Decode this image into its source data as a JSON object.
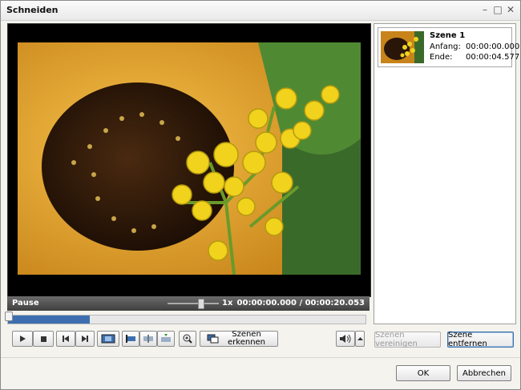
{
  "window": {
    "title": "Schneiden"
  },
  "player": {
    "status": "Pause",
    "speed": "1x",
    "timecode": "00:00:00.000 / 00:00:20.053",
    "position_fraction": 0.0
  },
  "controls": {
    "icons": [
      "play-icon",
      "stop-icon",
      "prev-frame-icon",
      "next-frame-icon",
      "filmstrip-icon",
      "mark-start-icon",
      "cut-icon",
      "mark-end-icon",
      "zoom-icon",
      "scenes-icon",
      "volume-icon",
      "up-arrow-icon"
    ],
    "detect_scenes_label": "Szenen\nerkennen",
    "volume_level": 0.5
  },
  "scenes": [
    {
      "name": "Szene 1",
      "start_label": "Anfang:",
      "start": "00:00:00.000",
      "end_label": "Ende:",
      "end": "00:00:04.577"
    }
  ],
  "actions": {
    "merge_label": "Szenen vereinigen",
    "remove_label": "Szene entfernen"
  },
  "footer": {
    "ok_label": "OK",
    "cancel_label": "Abbrechen"
  },
  "colors": {
    "accent": "#3d6fb0",
    "status_bar": "#4f4f4f"
  }
}
